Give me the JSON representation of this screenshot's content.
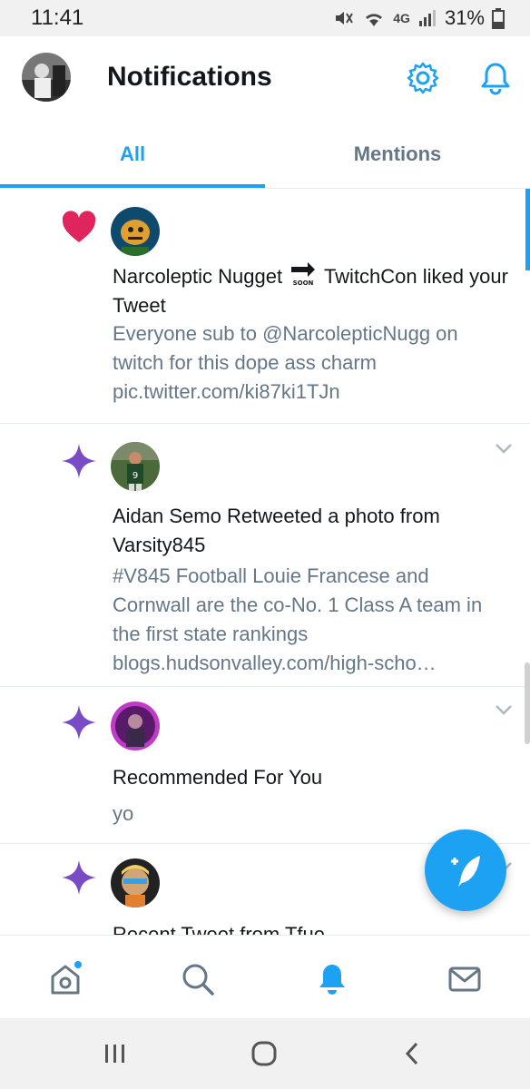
{
  "status_bar": {
    "time": "11:41",
    "network": "4G",
    "battery": "31%"
  },
  "header": {
    "title": "Notifications"
  },
  "tabs": [
    {
      "label": "All",
      "active": true
    },
    {
      "label": "Mentions",
      "active": false
    }
  ],
  "notifications": [
    {
      "icon": "heart-icon",
      "title_before": "Narcoleptic Nugget",
      "title_after": " TwitchCon liked your Tweet",
      "soon_badge": "SOON",
      "body": "Everyone sub to @NarcolepticNugg on twitch for this dope ass charm pic.twitter.com/ki87ki1TJn"
    },
    {
      "icon": "sparkle-icon",
      "title": "Aidan Semo Retweeted a photo from Varsity845",
      "body": "#V845 Football Louie Francese and Cornwall are the co-No. 1 Class A team in the first state rankings blogs.hudsonvalley.com/high-scho…"
    },
    {
      "icon": "sparkle-icon",
      "title": "Recommended For You",
      "body": "yo"
    },
    {
      "icon": "sparkle-icon",
      "title": "Recent Tweet from Tfue",
      "body": ""
    }
  ],
  "colors": {
    "accent": "#1da1f2",
    "heart": "#e0245e",
    "sparkle": "#794bc4",
    "muted": "#657786"
  }
}
